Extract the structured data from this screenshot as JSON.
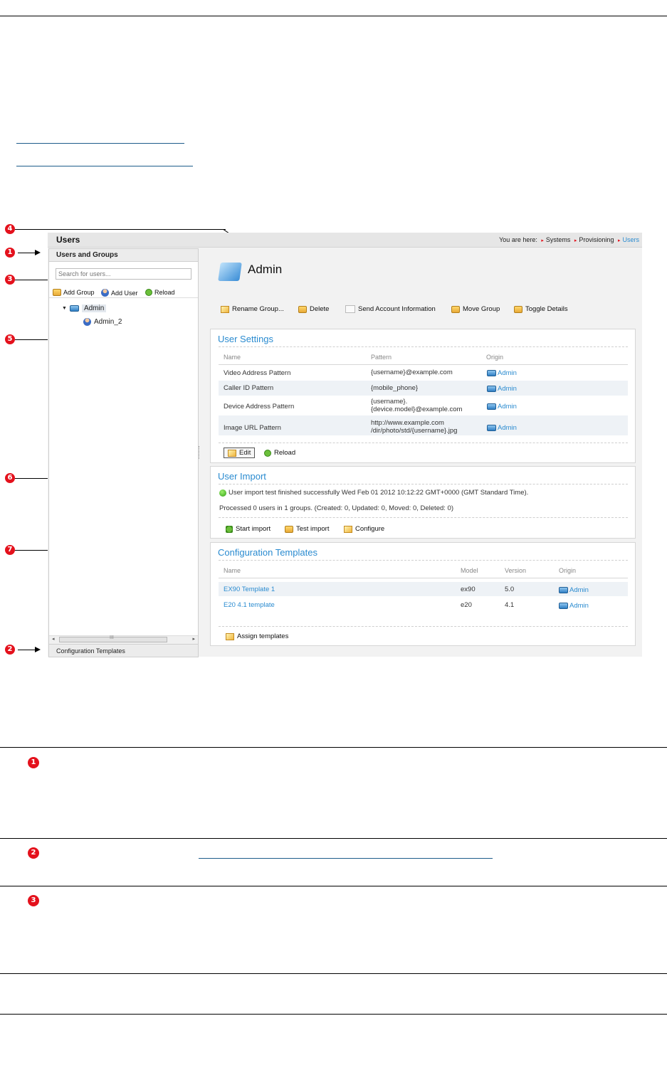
{
  "screenshot": {
    "topbar": {
      "title": "Users",
      "breadcrumb_prefix": "You are here:",
      "breadcrumbs": [
        "Systems",
        "Provisioning",
        "Users"
      ]
    },
    "left": {
      "header": "Users and Groups",
      "search_placeholder": "Search for users...",
      "toolbar": {
        "add_group": "Add Group",
        "add_user": "Add User",
        "reload": "Reload"
      },
      "tree": {
        "root": "Admin",
        "child": "Admin_2"
      },
      "scrollbar_glyph": "III",
      "footer": "Configuration Templates"
    },
    "main": {
      "group_title": "Admin",
      "toolbar": {
        "rename": "Rename Group...",
        "delete": "Delete",
        "send_account": "Send Account Information",
        "move_group": "Move Group",
        "toggle_details": "Toggle Details"
      },
      "user_settings": {
        "title": "User Settings",
        "headers": {
          "name": "Name",
          "pattern": "Pattern",
          "origin": "Origin"
        },
        "rows": [
          {
            "name": "Video Address Pattern",
            "pattern": "{username}@example.com",
            "origin": "Admin"
          },
          {
            "name": "Caller ID Pattern",
            "pattern": "{mobile_phone}",
            "origin": "Admin"
          },
          {
            "name": "Device Address Pattern",
            "pattern_line1": "{username}.",
            "pattern_line2": "{device.model}@example.com",
            "origin": "Admin"
          },
          {
            "name": "Image URL Pattern",
            "pattern_line1": "http://www.example.com",
            "pattern_line2": "/dir/photo/std/{username}.jpg",
            "origin": "Admin"
          }
        ],
        "edit": "Edit",
        "reload": "Reload"
      },
      "user_import": {
        "title": "User Import",
        "status": "User import test finished successfully Wed Feb 01 2012 10:12:22 GMT+0000 (GMT Standard Time).",
        "processed": "Processed 0 users in 1 groups. (Created: 0, Updated: 0, Moved: 0, Deleted: 0)",
        "start_import": "Start import",
        "test_import": "Test import",
        "configure": "Configure"
      },
      "config_templates": {
        "title": "Configuration Templates",
        "headers": {
          "name": "Name",
          "model": "Model",
          "version": "Version",
          "origin": "Origin"
        },
        "rows": [
          {
            "name": "EX90 Template 1",
            "model": "ex90",
            "version": "5.0",
            "origin": "Admin"
          },
          {
            "name": "E20 4.1 template",
            "model": "e20",
            "version": "4.1",
            "origin": "Admin"
          }
        ],
        "assign": "Assign templates"
      }
    }
  },
  "callouts": [
    "1",
    "2",
    "3",
    "4",
    "5",
    "6",
    "7"
  ],
  "colors": {
    "accent": "#2a8bd0",
    "callout": "#e4111c"
  }
}
